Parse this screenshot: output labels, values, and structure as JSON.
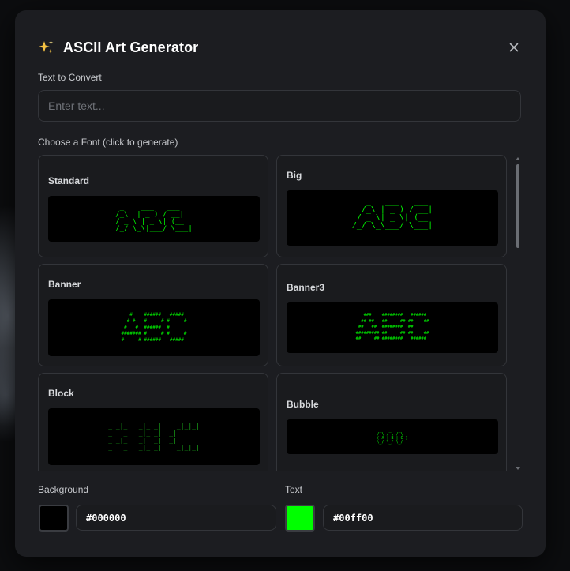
{
  "dialog": {
    "title": "ASCII Art Generator",
    "title_icon": "sparkles-icon",
    "close_icon": "close-icon"
  },
  "text_input": {
    "label": "Text to Convert",
    "placeholder": "Enter text...",
    "value": ""
  },
  "fonts_section": {
    "label": "Choose a Font (click to generate)",
    "fonts": [
      {
        "name": "Standard",
        "preview": " _    ___   ___ \n/_\\  | _ ) / __|\n/ _ \\ | _ \\| (__ \n/_/ \\_\\|___/ \\___|"
      },
      {
        "name": "Big",
        "preview": "   _   ___   ___ \n  /_\\ | _ ) / __|\n / _ \\| _ \\| (__ \n/_/ \\_\\___/ \\___|\n                 "
      },
      {
        "name": "Banner",
        "preview": "   #    ######   #####\n  # #   #     # #     #\n #   #  ######  #\n####### #     # #     #\n#     # ######   #####"
      },
      {
        "name": "Banner3",
        "preview": "   ###    ########   ######\n  ## ##   ##     ## ##    ##\n ##   ##  ########  ##\n######### ##     ## ##    ##\n##     ## ########   ######"
      },
      {
        "name": "Block",
        "preview": "_|_|_|  _|_|_|    _|_|_|\n_|  _|  _|_|_|  _|\n_|_|_|  _|  _|  _|\n_|  _|  _|_|_|    _|_|_|"
      },
      {
        "name": "Bubble",
        "preview": " _   _   _ \n/ \\ / \\ / \\\n( A | B | C )\n\\_/ \\_/ \\_/"
      }
    ]
  },
  "colors": {
    "background": {
      "label": "Background",
      "value": "#000000",
      "swatch": "#000000"
    },
    "text": {
      "label": "Text",
      "value": "#00ff00",
      "swatch": "#00ff00"
    }
  }
}
